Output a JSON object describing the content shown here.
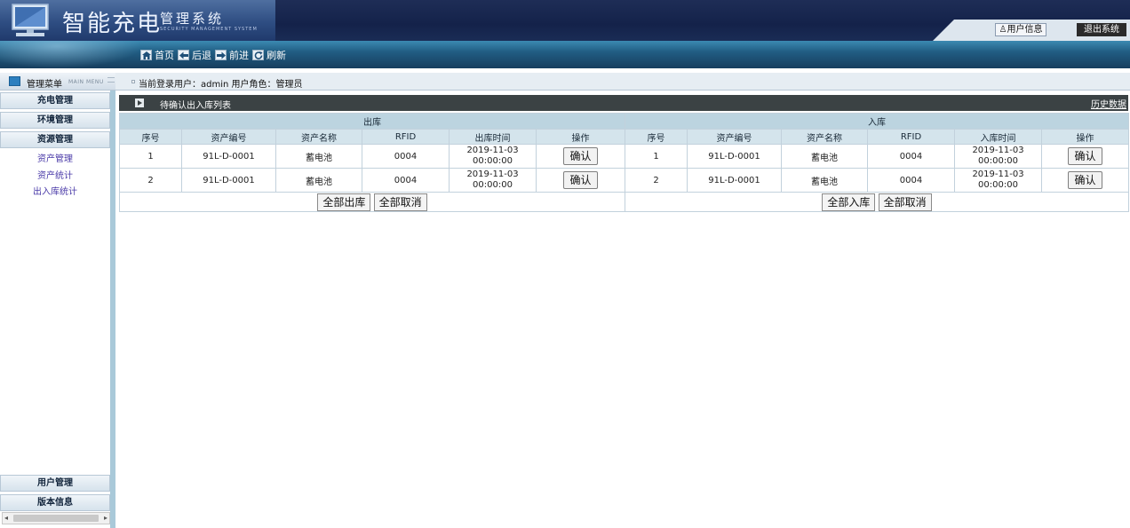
{
  "header": {
    "title": "智能充电",
    "subtitle": "管理系统",
    "subtitle_en": "SECURITY MANAGEMENT SYSTEM",
    "user_info_label": "用户信息",
    "logout_label": "退出系统"
  },
  "nav": {
    "home": "首页",
    "back": "后退",
    "forward": "前进",
    "refresh": "刷新"
  },
  "menu_header": {
    "title": "管理菜单",
    "title_en": "MAIN MENU"
  },
  "current_user": "当前登录用户：admin  用户角色：管理员",
  "sidebar": {
    "categories": [
      {
        "label": "充电管理"
      },
      {
        "label": "环境管理"
      },
      {
        "label": "资源管理"
      }
    ],
    "subitems": [
      {
        "label": "资产管理"
      },
      {
        "label": "资产统计"
      },
      {
        "label": "出入库统计"
      }
    ],
    "bottom": [
      {
        "label": "用户管理"
      },
      {
        "label": "版本信息"
      }
    ]
  },
  "panel": {
    "title": "待确认出入库列表",
    "history_link": "历史数据"
  },
  "outbound": {
    "section_title": "出库",
    "columns": [
      "序号",
      "资产编号",
      "资产名称",
      "RFID",
      "出库时间",
      "操作"
    ],
    "rows": [
      {
        "no": "1",
        "asset_id": "91L-D-0001",
        "name": "蓄电池",
        "rfid": "0004",
        "date": "2019-11-03",
        "time": "00:00:00",
        "action": "确认"
      },
      {
        "no": "2",
        "asset_id": "91L-D-0001",
        "name": "蓄电池",
        "rfid": "0004",
        "date": "2019-11-03",
        "time": "00:00:00",
        "action": "确认"
      }
    ],
    "btn_all": "全部出库",
    "btn_cancel": "全部取消"
  },
  "inbound": {
    "section_title": "入库",
    "columns": [
      "序号",
      "资产编号",
      "资产名称",
      "RFID",
      "入库时间",
      "操作"
    ],
    "rows": [
      {
        "no": "1",
        "asset_id": "91L-D-0001",
        "name": "蓄电池",
        "rfid": "0004",
        "date": "2019-11-03",
        "time": "00:00:00",
        "action": "确认"
      },
      {
        "no": "2",
        "asset_id": "91L-D-0001",
        "name": "蓄电池",
        "rfid": "0004",
        "date": "2019-11-03",
        "time": "00:00:00",
        "action": "确认"
      }
    ],
    "btn_all": "全部入库",
    "btn_cancel": "全部取消"
  },
  "colors": {
    "header_dark": "#14224a",
    "nav_blue": "#215d83",
    "panel_bar": "#3b4244",
    "table_section": "#bcd4e0",
    "table_header": "#d4e4ec",
    "sidebar_link": "#4a3aa8"
  },
  "icons": {
    "logo": "monitor-icon",
    "home": "home-icon",
    "back": "arrow-left-icon",
    "forward": "arrow-right-icon",
    "refresh": "refresh-icon",
    "user": "user-icon",
    "menu": "menu-icon",
    "panel": "play-icon"
  }
}
